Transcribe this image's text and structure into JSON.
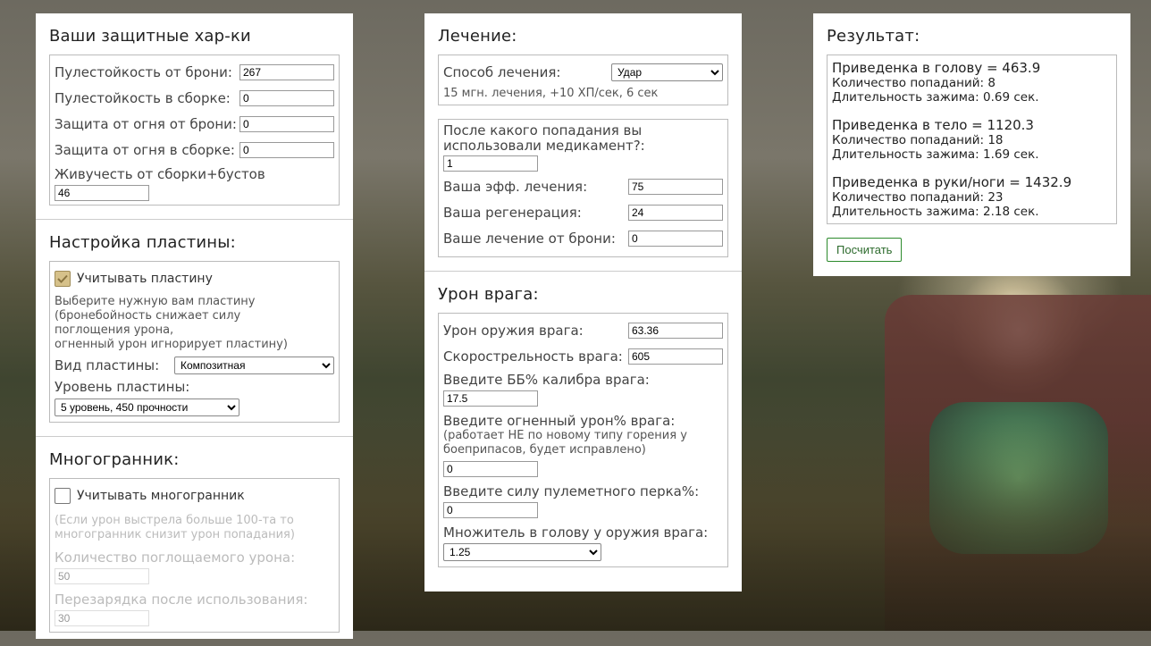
{
  "defense": {
    "title": "Ваши защитные хар-ки",
    "fields": [
      {
        "label": "Пулестойкость от брони:",
        "value": "267"
      },
      {
        "label": "Пулестойкость в сборке:",
        "value": "0"
      },
      {
        "label": "Защита от огня от брони:",
        "value": "0"
      },
      {
        "label": "Защита от огня в сборке:",
        "value": "0"
      }
    ],
    "vitality_label": "Живучесть от сборки+бустов",
    "vitality_value": "46"
  },
  "plate": {
    "title": "Настройка пластины:",
    "checkbox_label": "Учитывать пластину",
    "checked": true,
    "note_line1": "Выберите нужную вам пластину",
    "note_line2": "(бронебойность снижает силу",
    "note_line3": "поглощения урона,",
    "note_line4": "огненный урон игнорирует пластину)",
    "type_label": "Вид пластины:",
    "type_value": "Композитная",
    "level_label": "Уровень пластины:",
    "level_value": "5 уровень, 450 прочности"
  },
  "polyhedron": {
    "title": "Многогранник:",
    "checkbox_label": "Учитывать многогранник",
    "checked": false,
    "note_line1": "(Если урон выстрела больше 100-та то",
    "note_line2": "многогранник снизит урон попадания)",
    "absorb_label": "Количество поглощаемого урона:",
    "absorb_value": "50",
    "reload_label": "Перезарядка после использования:",
    "reload_value": "30"
  },
  "healing": {
    "title": "Лечение:",
    "method_label": "Способ лечения:",
    "method_value": "Удар",
    "method_note": "15 мгн. лечения, +10 ХП/сек, 6 сек",
    "after_hit_label_1": "После какого попадания вы",
    "after_hit_label_2": "использовали медикамент?:",
    "after_hit_value": "1",
    "fields": [
      {
        "label": "Ваша эфф. лечения:",
        "value": "75"
      },
      {
        "label": "Ваша регенерация:",
        "value": "24"
      },
      {
        "label": "Ваше лечение от брони:",
        "value": "0"
      }
    ]
  },
  "enemy": {
    "title": "Урон врага:",
    "weapon_damage_label": "Урон оружия врага:",
    "weapon_damage_value": "63.36",
    "fire_rate_label": "Скорострельность врага:",
    "fire_rate_value": "605",
    "ap_label": "Введите ББ% калибра врага:",
    "ap_value": "17.5",
    "fire_dmg_label": "Введите огненный урон% врага:",
    "fire_dmg_note1": "(работает НЕ по новому типу горения у",
    "fire_dmg_note2": "боеприпасов, будет исправлено)",
    "fire_dmg_value": "0",
    "mg_perk_label": "Введите силу пулеметного перка%:",
    "mg_perk_value": "0",
    "head_mult_label": "Множитель в голову у оружия врага:",
    "head_mult_value": "1.25"
  },
  "result": {
    "title": "Результат:",
    "blocks": [
      {
        "title": "Приведенка в голову = 463.9",
        "hits": "Количество попаданий: 8",
        "hold": "Длительность зажима: 0.69 сек."
      },
      {
        "title": "Приведенка в тело = 1120.3",
        "hits": "Количество попаданий: 18",
        "hold": "Длительность зажима: 1.69 сек."
      },
      {
        "title": "Приведенка в руки/ноги = 1432.9",
        "hits": "Количество попаданий: 23",
        "hold": "Длительность зажима: 2.18 сек."
      }
    ],
    "button_label": "Посчитать"
  },
  "colors": {
    "button_border": "#2c8a2c",
    "checkbox_checked": "#d6c18a"
  }
}
